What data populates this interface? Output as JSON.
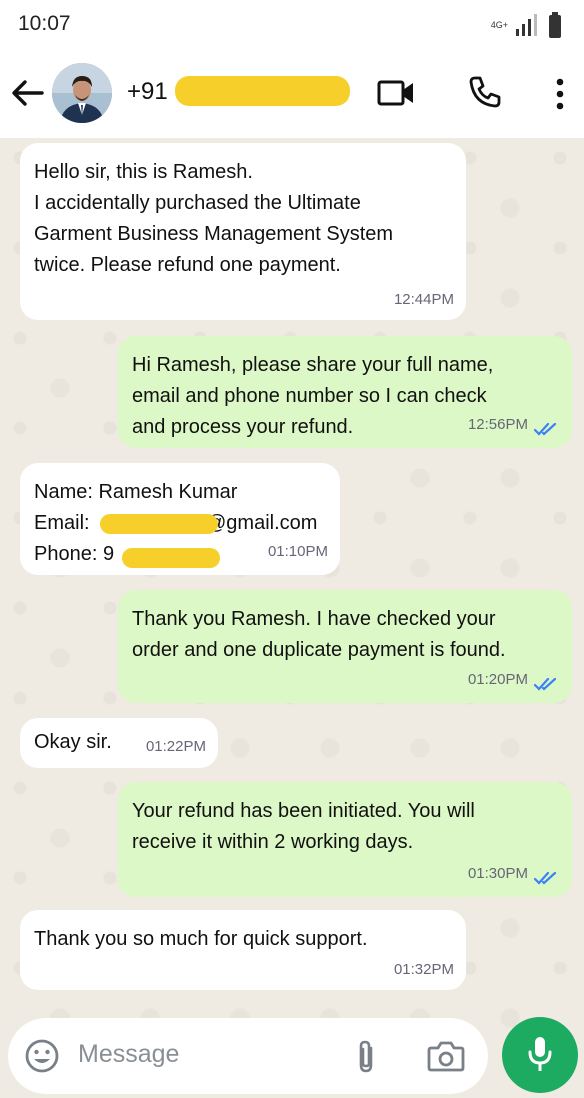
{
  "status": {
    "time": "10:07",
    "network": "4G+"
  },
  "header": {
    "contact_prefix": "+91"
  },
  "messages": [
    {
      "side": "in",
      "lines": [
        "Hello sir, this is Ramesh.",
        "I accidentally purchased the Ultimate",
        "Garment Business Management System",
        "twice. Please refund one payment."
      ],
      "time": "12:44PM"
    },
    {
      "side": "out",
      "lines": [
        "Hi Ramesh, please share your full name,",
        "email and phone number so I can check",
        "and process your refund."
      ],
      "time": "12:56PM"
    },
    {
      "side": "in",
      "lines": [
        "Name: Ramesh Kumar",
        "Email:",
        "@gmail.com",
        "Phone: 9"
      ],
      "time": "01:10PM"
    },
    {
      "side": "out",
      "lines": [
        "Thank you Ramesh. I have checked your",
        "order and one duplicate payment is found."
      ],
      "time": "01:20PM"
    },
    {
      "side": "in",
      "lines": [
        "Okay sir."
      ],
      "time": "01:22PM"
    },
    {
      "side": "out",
      "lines": [
        "Your refund has been initiated. You will",
        "receive it within 2 working days."
      ],
      "time": "01:30PM"
    },
    {
      "side": "in",
      "lines": [
        "Thank you so much for quick support."
      ],
      "time": "01:32PM"
    }
  ],
  "input": {
    "placeholder": "Message"
  },
  "colors": {
    "outgoing_bubble": "#dcf8c6",
    "incoming_bubble": "#ffffff",
    "chat_bg": "#efeae2",
    "mic_green": "#1daa61",
    "read_ticks": "#3b82f6",
    "redaction": "#f7cf2a"
  },
  "icons": [
    "back-arrow-icon",
    "video-call-icon",
    "phone-icon",
    "more-options-icon",
    "emoji-icon",
    "attachment-icon",
    "camera-icon",
    "mic-icon",
    "read-ticks-icon"
  ]
}
